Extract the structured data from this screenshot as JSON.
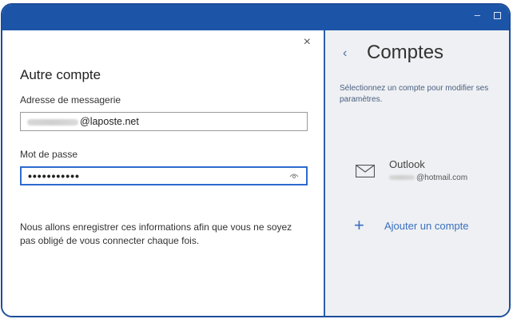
{
  "dialog": {
    "close_icon": "×",
    "title": "Autre compte",
    "email_label": "Adresse de messagerie",
    "email_value": "@laposte.net",
    "password_label": "Mot de passe",
    "password_value": "•••••••••••",
    "note": "Nous allons enregistrer ces informations afin que vous ne soyez pas obligé de vous connecter chaque fois."
  },
  "panel": {
    "back_icon": "‹",
    "title": "Comptes",
    "subtitle": "Sélectionnez un compte pour modifier ses paramètres.",
    "accounts": [
      {
        "name": "Outlook",
        "email": "@hotmail.com",
        "icon": "mail-icon"
      }
    ],
    "add_icon": "+",
    "add_label": "Ajouter un compte"
  },
  "window": {
    "minimize_icon": "–",
    "maximize_icon": "square"
  },
  "colors": {
    "titlebar": "#1c55a8",
    "accent": "#2d6bd0",
    "panel_bg": "#eef0f3",
    "link": "#3a6fbf"
  }
}
